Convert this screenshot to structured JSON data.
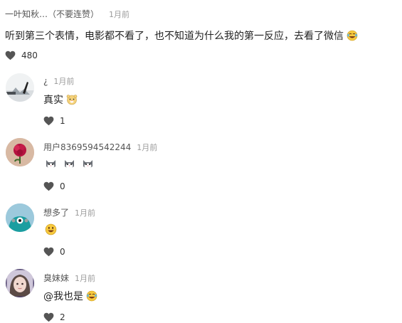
{
  "post": {
    "author": "一叶知秋…（不要连赞）",
    "time": "1月前",
    "text": "听到第三个表情，电影都不看了，也不知道为什么我的第一反应，去看了微信",
    "emoji_icon": "laughing-tears-emoji",
    "likes": "480"
  },
  "replies": [
    {
      "name": "¿",
      "time": "1月前",
      "text": "真实",
      "emoji_icon": "hamster-face-emoji",
      "likes": "1",
      "avatar_icon": "avatar-landscape"
    },
    {
      "name": "用户8369594542244",
      "time": "1月前",
      "text": "",
      "emoji_icon": "cat-face-emoji x3",
      "likes": "0",
      "avatar_icon": "avatar-red-flower"
    },
    {
      "name": "想多了",
      "time": "1月前",
      "text": "",
      "emoji_icon": "smiley-emoji",
      "likes": "0",
      "avatar_icon": "avatar-teal-monster"
    },
    {
      "name": "臭妹妹",
      "time": "1月前",
      "text": "@我也是",
      "emoji_icon": "laughing-tears-emoji",
      "likes": "2",
      "avatar_icon": "avatar-portrait"
    }
  ],
  "colors": {
    "heart": "#555555",
    "time": "#9b9b9b",
    "teal_avatar": "#1b9ea0",
    "flower_bg": "#d8b9a3"
  }
}
